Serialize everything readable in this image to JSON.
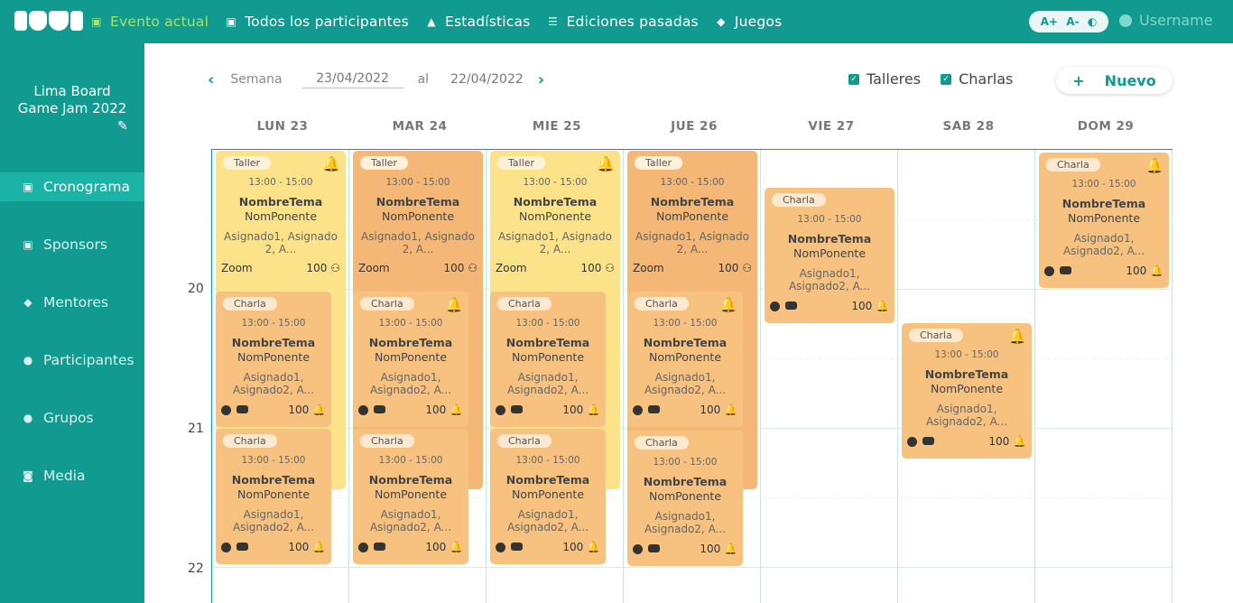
{
  "nav": {
    "items": [
      {
        "label": "Evento actual",
        "icon": "calendar-icon"
      },
      {
        "label": "Todos los participantes",
        "icon": "id-card-icon"
      },
      {
        "label": "Estadísticas",
        "icon": "chart-icon"
      },
      {
        "label": "Ediciones pasadas",
        "icon": "list-icon"
      },
      {
        "label": "Juegos",
        "icon": "gamepad-icon"
      }
    ],
    "font_up": "A+",
    "font_down": "A-",
    "theme_icon": "moon-icon",
    "username": "Username"
  },
  "sidebar": {
    "event_title": "Lima Board Game Jam 2022",
    "items": [
      {
        "label": "Cronograma",
        "icon": "calendar-icon"
      },
      {
        "label": "Sponsors",
        "icon": "briefcase-icon"
      },
      {
        "label": "Mentores",
        "icon": "graduation-cap-icon"
      },
      {
        "label": "Participantes",
        "icon": "people-icon"
      },
      {
        "label": "Grupos",
        "icon": "group-icon"
      },
      {
        "label": "Media",
        "icon": "camera-icon"
      }
    ]
  },
  "toolbar": {
    "week_label": "Semana",
    "start_date": "23/04/2022",
    "to_label": "al",
    "end_date": "22/04/2022",
    "filter_talleres": "Talleres",
    "filter_charlas": "Charlas",
    "new_plus": "+",
    "new_label": "Nuevo"
  },
  "calendar": {
    "days": [
      "LUN 23",
      "MAR 24",
      "MIE 25",
      "JUE 26",
      "VIE 27",
      "SAB 28",
      "DOM 29"
    ],
    "hours": [
      "20",
      "21",
      "22"
    ],
    "card": {
      "tag_taller": "Taller",
      "tag_charla": "Charla",
      "time": "13:00 - 15:00",
      "topic": "NombreTema",
      "speaker": "NomPonente",
      "assigned_a": "Asignado1, Asignado 2, A...",
      "assigned_b": "Asignado1, Asignado2, A...",
      "zoom": "Zoom",
      "count": "100"
    }
  }
}
